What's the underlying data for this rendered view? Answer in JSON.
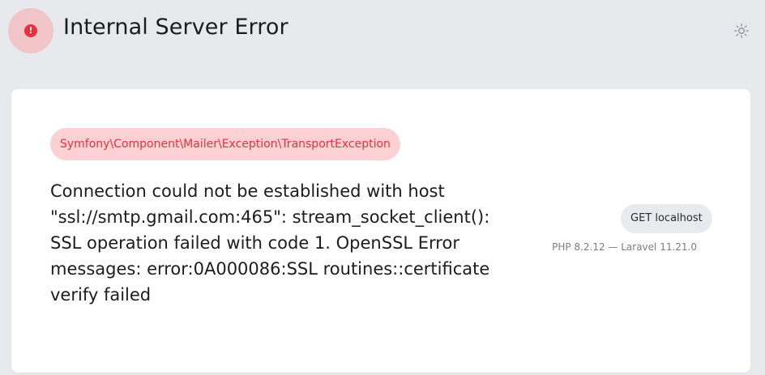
{
  "header": {
    "title": "Internal Server Error",
    "status_icon": "exclamation-circle-icon",
    "theme_toggle_icon": "sun-icon"
  },
  "error": {
    "exception_class": "Symfony\\Component\\Mailer\\Exception\\TransportException",
    "message": "Connection could not be established with host \"ssl://smtp.gmail.com:465\": stream_socket_client(): SSL operation failed with code 1. OpenSSL Error messages: error:0A000086:SSL routines::certificate verify failed"
  },
  "request": {
    "method_url": "GET localhost",
    "versions": "PHP 8.2.12 — Laravel 11.21.0"
  },
  "colors": {
    "background": "#e8e9ed",
    "card": "#ffffff",
    "error_red": "#e5323c",
    "error_badge_bg": "#f2c6c9",
    "exception_pill_bg": "#fbd1d3"
  }
}
